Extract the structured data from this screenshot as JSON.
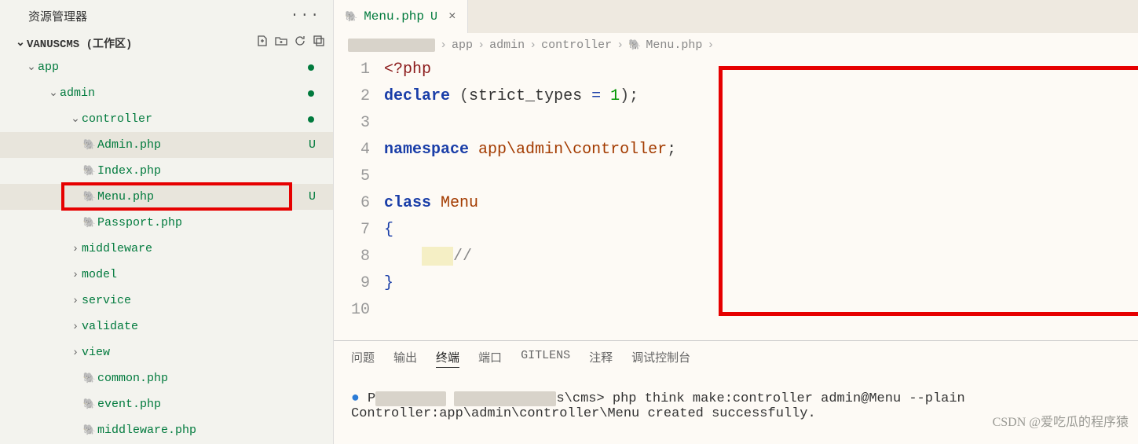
{
  "sidebar": {
    "title": "资源管理器",
    "section": "VANUSCMS (工作区)",
    "actions": [
      "new-file",
      "new-folder",
      "refresh",
      "collapse"
    ],
    "tree": [
      {
        "depth": 0,
        "chev": "down",
        "label": "app",
        "dot": true
      },
      {
        "depth": 1,
        "chev": "down",
        "label": "admin",
        "dot": true
      },
      {
        "depth": 2,
        "chev": "down",
        "label": "controller",
        "dot": true
      },
      {
        "depth": 3,
        "icon": "php",
        "label": "Admin.php",
        "status": "U",
        "active": true
      },
      {
        "depth": 3,
        "icon": "php",
        "label": "Index.php"
      },
      {
        "depth": 3,
        "icon": "php",
        "label": "Menu.php",
        "status": "U",
        "active": true,
        "redbox": true
      },
      {
        "depth": 3,
        "icon": "php",
        "label": "Passport.php"
      },
      {
        "depth": 2,
        "chev": "right",
        "label": "middleware"
      },
      {
        "depth": 2,
        "chev": "right",
        "label": "model"
      },
      {
        "depth": 2,
        "chev": "right",
        "label": "service"
      },
      {
        "depth": 2,
        "chev": "right",
        "label": "validate"
      },
      {
        "depth": 2,
        "chev": "right",
        "label": "view"
      },
      {
        "depth": 2,
        "icon": "php",
        "label": "common.php"
      },
      {
        "depth": 2,
        "icon": "php",
        "label": "event.php"
      },
      {
        "depth": 2,
        "icon": "php",
        "label": "middleware.php"
      }
    ]
  },
  "tab": {
    "label": "Menu.php",
    "modified": "U"
  },
  "breadcrumb": [
    "app",
    "admin",
    "controller",
    "Menu.php"
  ],
  "code": {
    "lines": [
      {
        "n": 1,
        "html": "<span class='c-tag'>&lt;?php</span>"
      },
      {
        "n": 2,
        "html": "<span class='c-key'>declare</span> <span class='c-punc'>(</span>strict_types <span class='c-op'>=</span> <span class='c-num'>1</span><span class='c-punc'>);</span>"
      },
      {
        "n": 3,
        "html": ""
      },
      {
        "n": 4,
        "html": "<span class='c-key'>namespace</span> <span class='c-name'>app\\admin\\controller</span><span class='c-punc'>;</span>"
      },
      {
        "n": 5,
        "html": ""
      },
      {
        "n": 6,
        "html": "<span class='c-key'>class</span> <span class='c-name'>Menu</span>"
      },
      {
        "n": 7,
        "html": "<span class='c-brace'>{</span>"
      },
      {
        "n": 8,
        "html": "    <span class='cursor-hl'></span><span class='c-comment'>//</span>"
      },
      {
        "n": 9,
        "html": "<span class='c-brace'>}</span>"
      },
      {
        "n": 10,
        "html": ""
      }
    ]
  },
  "panel": {
    "tabs": [
      "问题",
      "输出",
      "终端",
      "端口",
      "GITLENS",
      "注释",
      "调试控制台"
    ],
    "active": 2,
    "term_line1_prefix": "P",
    "term_line1_mid": "s\\cms>",
    "term_line1_cmd": " php think make:controller admin@Menu --plain",
    "term_line2": "Controller:app\\admin\\controller\\Menu created successfully."
  },
  "watermark": "CSDN @爱吃瓜的程序猿"
}
